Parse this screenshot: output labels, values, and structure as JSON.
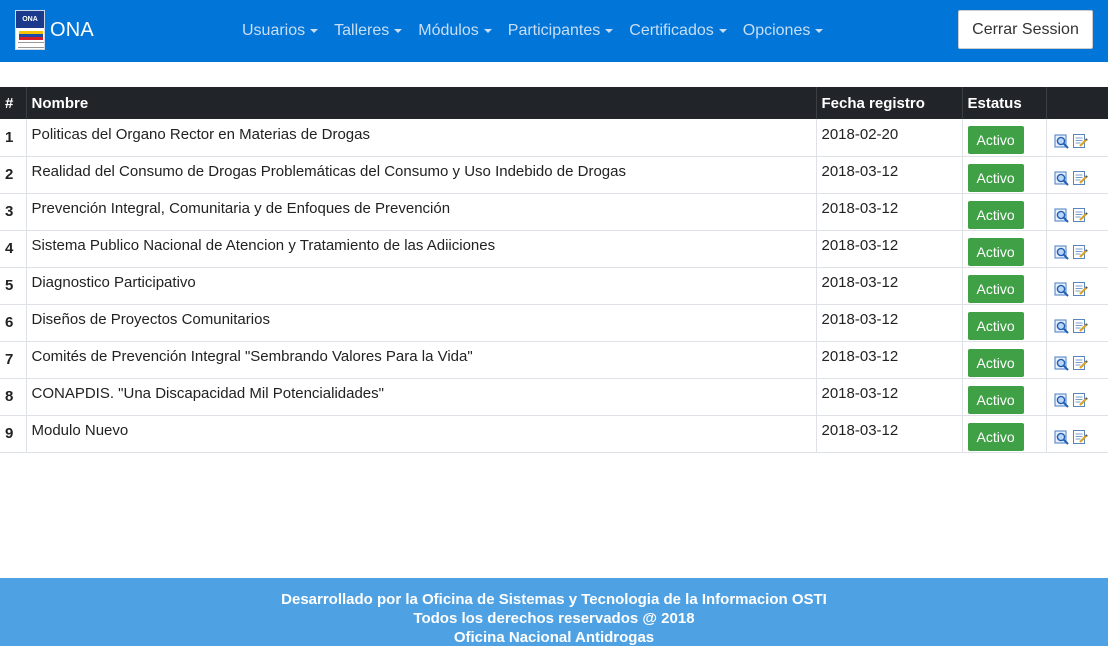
{
  "app": {
    "brand_name": "ONA",
    "logo_text": "ONA",
    "nav_items": [
      "Usuarios",
      "Talleres",
      "Módulos",
      "Participantes",
      "Certificados",
      "Opciones"
    ],
    "logout_label": "Cerrar Session"
  },
  "table": {
    "headers": [
      "#",
      "Nombre",
      "Fecha registro",
      "Estatus",
      ""
    ],
    "rows": [
      {
        "num": "1",
        "name": "Politicas del Organo Rector en Materias de Drogas",
        "date": "2018-02-20",
        "status": "Activo"
      },
      {
        "num": "2",
        "name": "Realidad del Consumo de Drogas Problemáticas del Consumo y Uso Indebido de Drogas",
        "date": "2018-03-12",
        "status": "Activo"
      },
      {
        "num": "3",
        "name": "Prevención Integral, Comunitaria y de Enfoques de Prevención",
        "date": "2018-03-12",
        "status": "Activo"
      },
      {
        "num": "4",
        "name": "Sistema Publico Nacional de Atencion y Tratamiento de las Adiiciones",
        "date": "2018-03-12",
        "status": "Activo"
      },
      {
        "num": "5",
        "name": "Diagnostico Participativo",
        "date": "2018-03-12",
        "status": "Activo"
      },
      {
        "num": "6",
        "name": "Diseños de Proyectos Comunitarios",
        "date": "2018-03-12",
        "status": "Activo"
      },
      {
        "num": "7",
        "name": "Comités de Prevención Integral \"Sembrando Valores Para la Vida\"",
        "date": "2018-03-12",
        "status": "Activo"
      },
      {
        "num": "8",
        "name": "CONAPDIS. \"Una Discapacidad Mil Potencialidades\"",
        "date": "2018-03-12",
        "status": "Activo"
      },
      {
        "num": "9",
        "name": "Modulo Nuevo",
        "date": "2018-03-12",
        "status": "Activo"
      }
    ]
  },
  "footer": {
    "line1": "Desarrollado por la Oficina de Sistemas y Tecnologia de la Informacion OSTI",
    "line2": "Todos los derechos reservados @ 2018",
    "line3": "Oficina Nacional Antidrogas"
  },
  "colors": {
    "navbar": "#0275d8",
    "table_header": "#212529",
    "status_badge": "#3fa046",
    "footer": "#4ea1e3"
  },
  "icons": {
    "row_action_1": "magnifier-view-icon",
    "row_action_2": "edit-document-icon"
  }
}
